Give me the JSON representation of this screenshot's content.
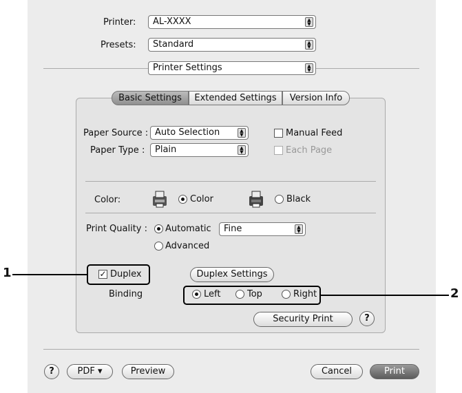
{
  "printer": {
    "label": "Printer:",
    "value": "AL-XXXX"
  },
  "presets": {
    "label": "Presets:",
    "value": "Standard"
  },
  "pane_menu": {
    "value": "Printer Settings"
  },
  "tabs": [
    {
      "label": "Basic Settings",
      "selected": true
    },
    {
      "label": "Extended Settings",
      "selected": false
    },
    {
      "label": "Version Info",
      "selected": false
    }
  ],
  "paper_source": {
    "label": "Paper Source :",
    "value": "Auto Selection"
  },
  "paper_type": {
    "label": "Paper Type :",
    "value": "Plain"
  },
  "manual_feed": {
    "label": "Manual Feed",
    "checked": false
  },
  "each_page": {
    "label": "Each Page",
    "checked": false,
    "enabled": false
  },
  "color": {
    "label": "Color:",
    "option_color": "Color",
    "option_black": "Black",
    "selected": "Color"
  },
  "print_quality": {
    "label": "Print Quality :",
    "automatic": "Automatic",
    "advanced": "Advanced",
    "selected": "Automatic",
    "level": "Fine"
  },
  "duplex": {
    "label": "Duplex",
    "checked": true,
    "settings_button": "Duplex Settings"
  },
  "binding": {
    "label": "Binding",
    "left": "Left",
    "top": "Top",
    "right": "Right",
    "selected": "Left"
  },
  "security_print_button": "Security Print",
  "footer": {
    "help": "?",
    "pdf": "PDF ▾",
    "preview": "Preview",
    "cancel": "Cancel",
    "print": "Print"
  },
  "callouts": {
    "one": "1",
    "two": "2"
  }
}
